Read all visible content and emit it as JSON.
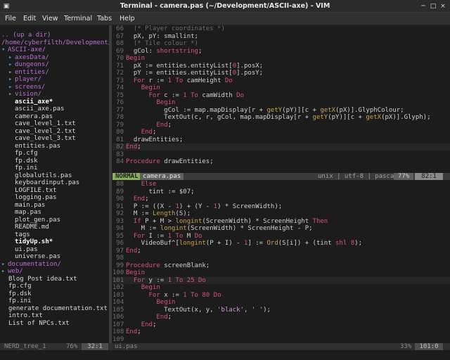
{
  "window": {
    "title": "Terminal - camera.pas (~/Development/ASCII-axe) - VIM",
    "min_glyph": "─",
    "max_glyph": "□",
    "close_glyph": "×"
  },
  "menu": [
    "File",
    "Edit",
    "View",
    "Terminal",
    "Tabs",
    "Help"
  ],
  "tree": {
    "updir": ".. (up a dir)",
    "path": "/home/cyberfilth/Development/",
    "items": [
      {
        "arrow": "▾",
        "text": "ASCII-axe/",
        "kind": "dir"
      },
      {
        "arrow": "▸",
        "text": "axesData/",
        "kind": "dir"
      },
      {
        "arrow": "▸",
        "text": "dungeons/",
        "kind": "dir"
      },
      {
        "arrow": "▸",
        "text": "entities/",
        "kind": "dir"
      },
      {
        "arrow": "▸",
        "text": "player/",
        "kind": "dir"
      },
      {
        "arrow": "▸",
        "text": "screens/",
        "kind": "dir"
      },
      {
        "arrow": "▸",
        "text": "vision/",
        "kind": "dir"
      },
      {
        "arrow": "",
        "text": "ascii_axe*",
        "kind": "bold"
      },
      {
        "arrow": "",
        "text": "ascii_axe.pas",
        "kind": "file"
      },
      {
        "arrow": "",
        "text": "camera.pas",
        "kind": "file"
      },
      {
        "arrow": "",
        "text": "cave_level_1.txt",
        "kind": "file"
      },
      {
        "arrow": "",
        "text": "cave_level_2.txt",
        "kind": "file"
      },
      {
        "arrow": "",
        "text": "cave_level_3.txt",
        "kind": "file"
      },
      {
        "arrow": "",
        "text": "entities.pas",
        "kind": "file"
      },
      {
        "arrow": "",
        "text": "fp.cfg",
        "kind": "file"
      },
      {
        "arrow": "",
        "text": "fp.dsk",
        "kind": "file"
      },
      {
        "arrow": "",
        "text": "fp.ini",
        "kind": "file"
      },
      {
        "arrow": "",
        "text": "globalutils.pas",
        "kind": "file"
      },
      {
        "arrow": "",
        "text": "keyboardinput.pas",
        "kind": "file"
      },
      {
        "arrow": "",
        "text": "LOGFILE.txt",
        "kind": "file"
      },
      {
        "arrow": "",
        "text": "logging.pas",
        "kind": "file"
      },
      {
        "arrow": "",
        "text": "main.pas",
        "kind": "file"
      },
      {
        "arrow": "",
        "text": "map.pas",
        "kind": "file"
      },
      {
        "arrow": "",
        "text": "plot_gen.pas",
        "kind": "file"
      },
      {
        "arrow": "",
        "text": "README.md",
        "kind": "file"
      },
      {
        "arrow": "",
        "text": "tags",
        "kind": "file"
      },
      {
        "arrow": "",
        "text": "tidyUp.sh*",
        "kind": "bold"
      },
      {
        "arrow": "",
        "text": "ui.pas",
        "kind": "file"
      },
      {
        "arrow": "",
        "text": "universe.pas",
        "kind": "file"
      },
      {
        "arrow": "▸",
        "text": "documentation/",
        "kind": "dir"
      },
      {
        "arrow": "▸",
        "text": "web/",
        "kind": "dir"
      },
      {
        "arrow": "",
        "text": "Blog Post idea.txt",
        "kind": "file"
      },
      {
        "arrow": "",
        "text": "fp.cfg",
        "kind": "file"
      },
      {
        "arrow": "",
        "text": "fp.dsk",
        "kind": "file"
      },
      {
        "arrow": "",
        "text": "fp.ini",
        "kind": "file"
      },
      {
        "arrow": "",
        "text": "generate documentation.txt",
        "kind": "file"
      },
      {
        "arrow": "",
        "text": "intro.txt",
        "kind": "file"
      },
      {
        "arrow": "",
        "text": "List of NPCs.txt",
        "kind": "file"
      }
    ]
  },
  "top_pane": {
    "lines": [
      {
        "n": "66",
        "t": [
          [
            "cmt",
            "  (* Player coordinates *)"
          ]
        ]
      },
      {
        "n": "67",
        "t": [
          [
            "pl",
            "  pX, pY: smallint;"
          ]
        ]
      },
      {
        "n": "68",
        "t": [
          [
            "cmt",
            "  (* Tile colour *)"
          ]
        ]
      },
      {
        "n": "69",
        "t": [
          [
            "pl",
            "  gCol: "
          ],
          [
            "kw",
            "shortstring"
          ],
          [
            "pl",
            ";"
          ]
        ]
      },
      {
        "n": "70",
        "t": [
          [
            "kw",
            "Begin"
          ]
        ]
      },
      {
        "n": "71",
        "t": [
          [
            "pl",
            "  pX := entities.entityList["
          ],
          [
            "num",
            "0"
          ],
          [
            "pl",
            "].posX;"
          ]
        ]
      },
      {
        "n": "72",
        "t": [
          [
            "pl",
            "  pY := entities.entityList["
          ],
          [
            "num",
            "0"
          ],
          [
            "pl",
            "].posY;"
          ]
        ]
      },
      {
        "n": "73",
        "t": [
          [
            "pl",
            "  "
          ],
          [
            "kw",
            "For"
          ],
          [
            "pl",
            " r := "
          ],
          [
            "num",
            "1"
          ],
          [
            "pl",
            " "
          ],
          [
            "kw",
            "To"
          ],
          [
            "pl",
            " camHeight "
          ],
          [
            "kw",
            "Do"
          ]
        ]
      },
      {
        "n": "74",
        "t": [
          [
            "pl",
            "    "
          ],
          [
            "kw",
            "Begin"
          ]
        ]
      },
      {
        "n": "75",
        "t": [
          [
            "pl",
            "      "
          ],
          [
            "kw",
            "For"
          ],
          [
            "pl",
            " c := "
          ],
          [
            "num",
            "1"
          ],
          [
            "pl",
            " "
          ],
          [
            "kw",
            "To"
          ],
          [
            "pl",
            " camWidth "
          ],
          [
            "kw",
            "Do"
          ]
        ]
      },
      {
        "n": "76",
        "t": [
          [
            "pl",
            "        "
          ],
          [
            "kw",
            "Begin"
          ]
        ]
      },
      {
        "n": "77",
        "t": [
          [
            "pl",
            "          gCol := map.mapDisplay[r + "
          ],
          [
            "fn",
            "getY"
          ],
          [
            "pl",
            "(pY)][c + "
          ],
          [
            "fn",
            "getX"
          ],
          [
            "pl",
            "(pX)].GlyphColour;"
          ]
        ]
      },
      {
        "n": "78",
        "t": [
          [
            "pl",
            "          TextOut(c, r, gCol, map.mapDisplay[r + "
          ],
          [
            "fn",
            "getY"
          ],
          [
            "pl",
            "(pY)][c + "
          ],
          [
            "fn",
            "getX"
          ],
          [
            "pl",
            "(pX)].Glyph);"
          ]
        ]
      },
      {
        "n": "79",
        "t": [
          [
            "pl",
            "        "
          ],
          [
            "kw",
            "End"
          ],
          [
            "pl",
            ";"
          ]
        ]
      },
      {
        "n": "80",
        "t": [
          [
            "pl",
            "    "
          ],
          [
            "kw",
            "End"
          ],
          [
            "pl",
            ";"
          ]
        ]
      },
      {
        "n": "81",
        "t": [
          [
            "pl",
            "  drawEntities;"
          ]
        ]
      },
      {
        "n": "82",
        "t": [
          [
            "kw",
            "End"
          ],
          [
            "pl",
            ";"
          ]
        ]
      },
      {
        "n": "83",
        "t": []
      },
      {
        "n": "84",
        "t": [
          [
            "kw",
            "Procedure"
          ],
          [
            "pl",
            " drawEntities;"
          ]
        ]
      }
    ]
  },
  "status_top": {
    "mode": "NORMAL",
    "file": "camera.pas",
    "info": "unix | utf-8 | pascal",
    "percent": "77%",
    "pos": "82:1"
  },
  "bottom_pane": {
    "lines": [
      {
        "n": "88",
        "t": [
          [
            "pl",
            "    "
          ],
          [
            "kw",
            "Else"
          ]
        ]
      },
      {
        "n": "89",
        "t": [
          [
            "pl",
            "      tint := $07;"
          ]
        ]
      },
      {
        "n": "90",
        "t": [
          [
            "pl",
            "  "
          ],
          [
            "kw",
            "End"
          ],
          [
            "pl",
            ";"
          ]
        ]
      },
      {
        "n": "91",
        "t": [
          [
            "pl",
            "  P := ((X - "
          ],
          [
            "num",
            "1"
          ],
          [
            "pl",
            ") + (Y - "
          ],
          [
            "num",
            "1"
          ],
          [
            "pl",
            ") * ScreenWidth);"
          ]
        ]
      },
      {
        "n": "92",
        "t": [
          [
            "pl",
            "  M := "
          ],
          [
            "fn",
            "Length"
          ],
          [
            "pl",
            "(S);"
          ]
        ]
      },
      {
        "n": "93",
        "t": [
          [
            "pl",
            "  "
          ],
          [
            "kw",
            "If"
          ],
          [
            "pl",
            " P + M > "
          ],
          [
            "fn",
            "longint"
          ],
          [
            "pl",
            "(ScreenWidth) * ScreenHeight "
          ],
          [
            "kw",
            "Then"
          ]
        ]
      },
      {
        "n": "94",
        "t": [
          [
            "pl",
            "    M := "
          ],
          [
            "fn",
            "longint"
          ],
          [
            "pl",
            "(ScreenWidth) * ScreenHeight - P;"
          ]
        ]
      },
      {
        "n": "95",
        "t": [
          [
            "pl",
            "  "
          ],
          [
            "kw",
            "For"
          ],
          [
            "pl",
            " I := "
          ],
          [
            "num",
            "1"
          ],
          [
            "pl",
            " "
          ],
          [
            "kw",
            "To"
          ],
          [
            "pl",
            " M "
          ],
          [
            "kw",
            "Do"
          ]
        ]
      },
      {
        "n": "96",
        "t": [
          [
            "pl",
            "    VideoBuf^["
          ],
          [
            "fn",
            "longint"
          ],
          [
            "pl",
            "(P + I) - "
          ],
          [
            "num",
            "1"
          ],
          [
            "pl",
            "] := "
          ],
          [
            "fn",
            "Ord"
          ],
          [
            "pl",
            "(S[i]) + (tint "
          ],
          [
            "kw",
            "shl"
          ],
          [
            "pl",
            " "
          ],
          [
            "num",
            "8"
          ],
          [
            "pl",
            ");"
          ]
        ]
      },
      {
        "n": "97",
        "t": [
          [
            "kw",
            "End"
          ],
          [
            "pl",
            ";"
          ]
        ]
      },
      {
        "n": "98",
        "t": []
      },
      {
        "n": "99",
        "t": [
          [
            "kw",
            "Procedure"
          ],
          [
            "pl",
            " screenBlank;"
          ]
        ]
      },
      {
        "n": "100",
        "t": [
          [
            "kw",
            "Begin"
          ]
        ]
      },
      {
        "n": "101",
        "t": [
          [
            "pl",
            "  "
          ],
          [
            "kw",
            "For"
          ],
          [
            "pl",
            " y := "
          ],
          [
            "num",
            "1"
          ],
          [
            "pl",
            " "
          ],
          [
            "kw",
            "To"
          ],
          [
            "pl",
            " "
          ],
          [
            "num",
            "25"
          ],
          [
            "pl",
            " "
          ],
          [
            "kw",
            "Do"
          ]
        ]
      },
      {
        "n": "102",
        "t": [
          [
            "pl",
            "    "
          ],
          [
            "kw",
            "Begin"
          ]
        ]
      },
      {
        "n": "103",
        "t": [
          [
            "pl",
            "      "
          ],
          [
            "kw",
            "For"
          ],
          [
            "pl",
            " x := "
          ],
          [
            "num",
            "1"
          ],
          [
            "pl",
            " "
          ],
          [
            "kw",
            "To"
          ],
          [
            "pl",
            " "
          ],
          [
            "num",
            "80"
          ],
          [
            "pl",
            " "
          ],
          [
            "kw",
            "Do"
          ]
        ]
      },
      {
        "n": "104",
        "t": [
          [
            "pl",
            "        "
          ],
          [
            "kw",
            "Begin"
          ]
        ]
      },
      {
        "n": "105",
        "t": [
          [
            "pl",
            "          TextOut(x, y, "
          ],
          [
            "str",
            "'black'"
          ],
          [
            "pl",
            ", "
          ],
          [
            "str",
            "' '"
          ],
          [
            "pl",
            ");"
          ]
        ]
      },
      {
        "n": "106",
        "t": [
          [
            "pl",
            "        "
          ],
          [
            "kw",
            "End"
          ],
          [
            "pl",
            ";"
          ]
        ]
      },
      {
        "n": "107",
        "t": [
          [
            "pl",
            "    "
          ],
          [
            "kw",
            "End"
          ],
          [
            "pl",
            ";"
          ]
        ]
      },
      {
        "n": "108",
        "t": [
          [
            "kw",
            "End"
          ],
          [
            "pl",
            ";"
          ]
        ]
      },
      {
        "n": "109",
        "t": []
      }
    ]
  },
  "status_bottom": {
    "tree_name": "NERD_tree_1",
    "tree_percent": "76%",
    "tree_pos": "32:1",
    "file": "ui.pas",
    "percent": "33%",
    "pos": "101:0"
  },
  "colors": {
    "accent_green": "#87af5f",
    "keyword": "#d6537a",
    "directory": "#bd6fd4",
    "function": "#c7a34f"
  }
}
